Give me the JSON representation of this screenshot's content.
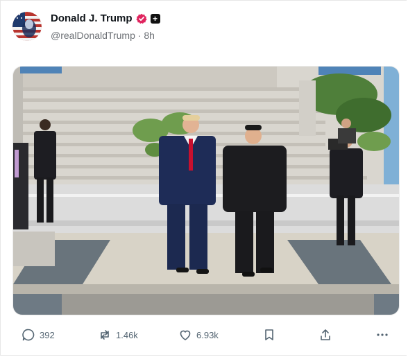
{
  "post": {
    "author": {
      "display_name": "Donald J. Trump",
      "handle": "@realDonaldTrump",
      "time": "8h",
      "separator": "·",
      "verified_icon": "verified-badge-icon",
      "plus_label": "+"
    },
    "stats": {
      "replies": "392",
      "reposts": "1.46k",
      "likes": "6.93k"
    },
    "icons": {
      "reply": "reply-icon",
      "repost": "repost-icon",
      "like": "heart-icon",
      "bookmark": "bookmark-icon",
      "share": "share-icon",
      "more": "more-icon"
    },
    "colors": {
      "verified": "#e0245e",
      "text_primary": "#0f1419",
      "text_secondary": "#536471"
    }
  }
}
